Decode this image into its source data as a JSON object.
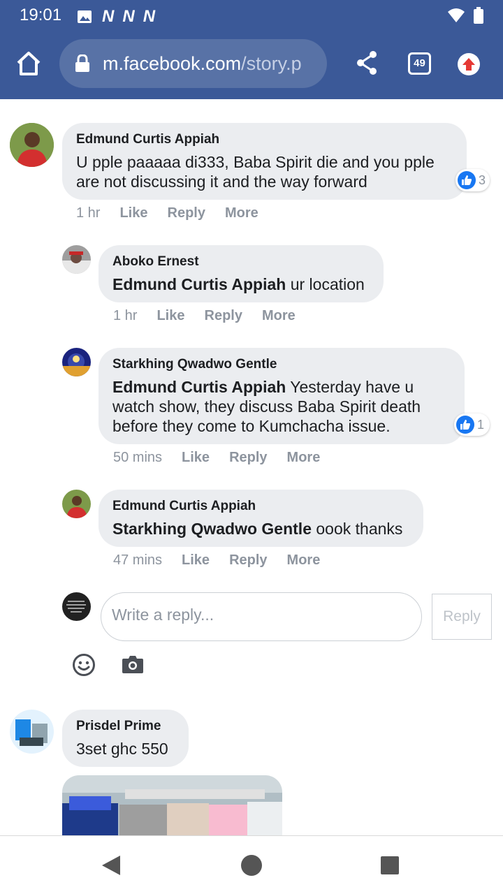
{
  "status_bar": {
    "time": "19:01",
    "notification_icons": [
      "image-icon",
      "n-icon",
      "n-icon",
      "n-icon"
    ],
    "right_icons": [
      "wifi-icon",
      "battery-icon"
    ]
  },
  "browser": {
    "url_domain": "m.facebook.com",
    "url_path": "/story.p",
    "tab_count": "49"
  },
  "comments": [
    {
      "author": "Edmund Curtis Appiah",
      "text": "U pple paaaaa di333, Baba Spirit die and you pple are not discussing it and the way forward",
      "time": "1 hr",
      "likes": "3",
      "replies": [
        {
          "author": "Aboko Ernest",
          "mention": "Edmund Curtis Appiah",
          "text": " ur location",
          "time": "1 hr"
        },
        {
          "author": "Starkhing Qwadwo Gentle",
          "mention": "Edmund Curtis Appiah",
          "text": " Yesterday have u watch show, they discuss Baba Spirit death before they come to Kumchacha issue.",
          "time": "50 mins",
          "likes": "1"
        },
        {
          "author": "Edmund Curtis Appiah",
          "mention": "Starkhing Qwadwo Gentle",
          "text": " oook thanks",
          "time": "47 mins"
        }
      ]
    },
    {
      "author": "Prisdel Prime",
      "text": "3set ghc 550"
    }
  ],
  "actions": {
    "like": "Like",
    "reply": "Reply",
    "more": "More"
  },
  "reply_box": {
    "placeholder": "Write a reply...",
    "button": "Reply"
  },
  "colors": {
    "brand": "#3b5998",
    "bubble": "#ebedf0",
    "like_blue": "#1877f2",
    "muted": "#8d949e"
  }
}
